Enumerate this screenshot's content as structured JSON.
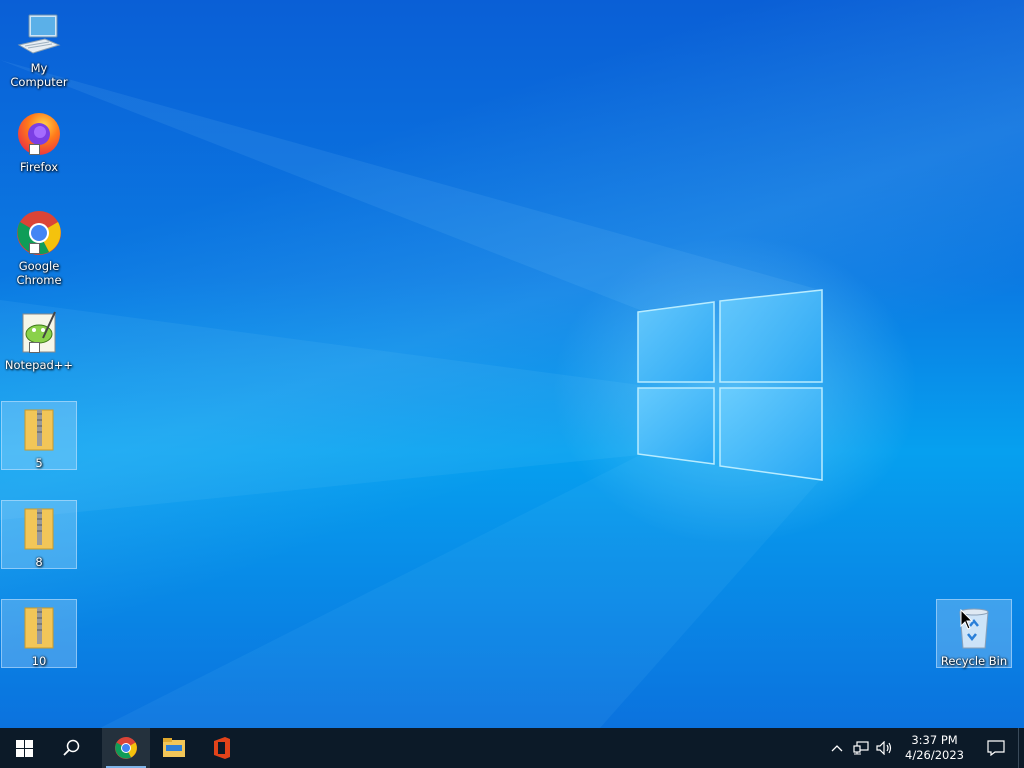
{
  "desktop": {
    "icons": [
      {
        "label": "My Computer",
        "icon": "computer-icon",
        "selected": false
      },
      {
        "label": "Firefox",
        "icon": "firefox-icon",
        "selected": false,
        "shortcut": true
      },
      {
        "label": "Google Chrome",
        "icon": "chrome-icon",
        "selected": false,
        "shortcut": true
      },
      {
        "label": "Notepad++",
        "icon": "notepadpp-icon",
        "selected": false,
        "shortcut": true
      },
      {
        "label": "5",
        "icon": "zip-folder-icon",
        "selected": true
      },
      {
        "label": "8",
        "icon": "zip-folder-icon",
        "selected": true
      },
      {
        "label": "10",
        "icon": "zip-folder-icon",
        "selected": true
      },
      {
        "label": "Recycle Bin",
        "icon": "recycle-bin-icon",
        "selected": true
      }
    ]
  },
  "taskbar": {
    "pinned": [
      "start-icon",
      "search-icon",
      "chrome-icon",
      "file-explorer-icon",
      "office-icon"
    ],
    "tray": {
      "time": "3:37 PM",
      "date": "4/26/2023"
    }
  },
  "colors": {
    "taskbar": "#0c1a28",
    "accent": "#7fb4e8"
  }
}
